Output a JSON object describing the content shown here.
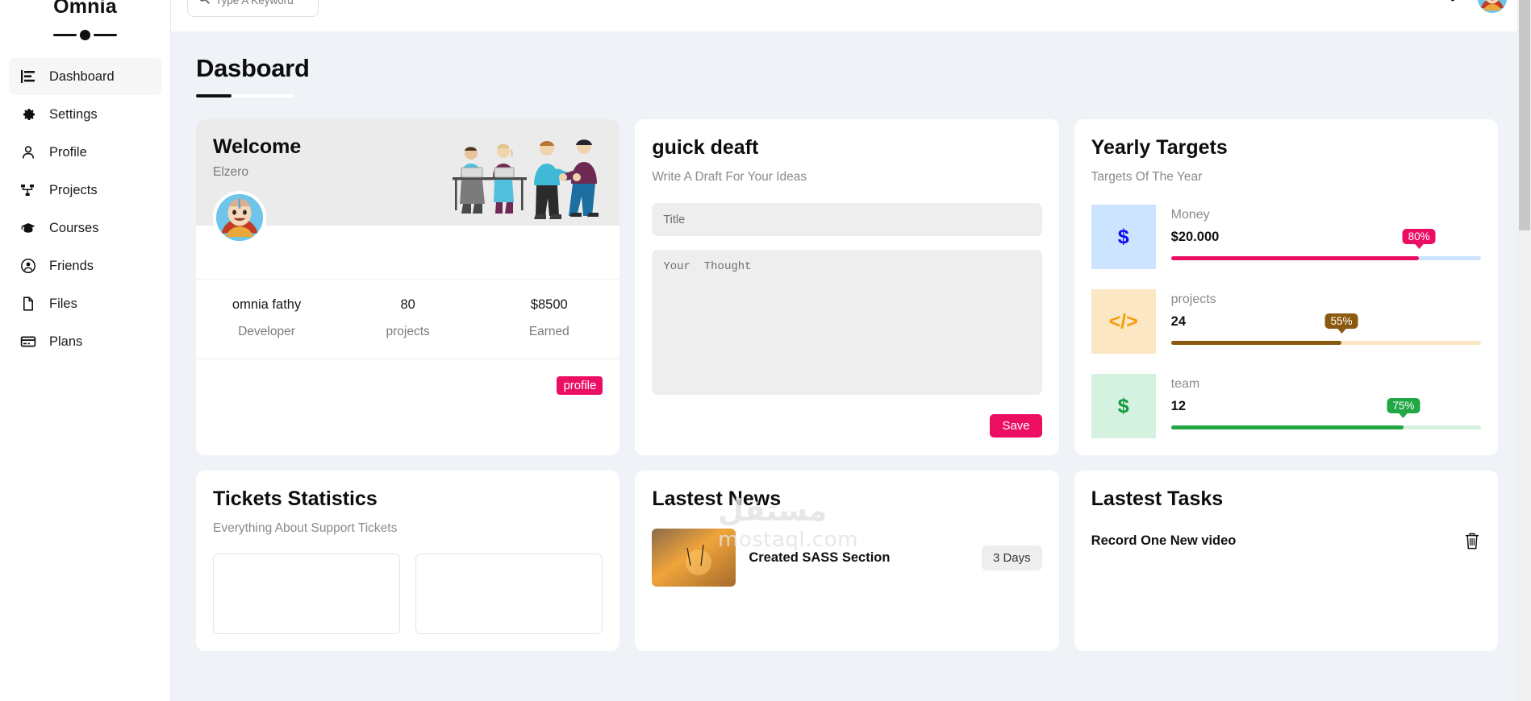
{
  "sidebar": {
    "brand": "Omnia",
    "items": [
      {
        "label": "Dashboard",
        "icon": "chart-bars-icon",
        "active": true
      },
      {
        "label": "Settings",
        "icon": "gear-icon",
        "active": false
      },
      {
        "label": "Profile",
        "icon": "user-icon",
        "active": false
      },
      {
        "label": "Projects",
        "icon": "sitemap-icon",
        "active": false
      },
      {
        "label": "Courses",
        "icon": "graduation-cap-icon",
        "active": false
      },
      {
        "label": "Friends",
        "icon": "user-circle-icon",
        "active": false
      },
      {
        "label": "Files",
        "icon": "file-icon",
        "active": false
      },
      {
        "label": "Plans",
        "icon": "credit-card-icon",
        "active": false
      }
    ]
  },
  "topbar": {
    "search_placeholder": "Type A Keyword",
    "search_value": "",
    "search_icon": "search-icon",
    "bell_icon": "bell-icon",
    "notification_dot_color": "#1b6ef3",
    "avatar_icon": "user-avatar"
  },
  "page": {
    "title": "Dasboard"
  },
  "welcome": {
    "title": "Welcome",
    "subtitle": "Elzero",
    "stats": [
      {
        "value": "omnia fathy",
        "label": "Developer"
      },
      {
        "value": "80",
        "label": "projects"
      },
      {
        "value": "$8500",
        "label": "Earned"
      }
    ],
    "button_label": "profile",
    "button_color": "#ec0e63"
  },
  "draft": {
    "title": "guick deaft",
    "subtitle": "Write A Draft For Your Ideas",
    "title_placeholder": "Title",
    "title_value": "",
    "thought_placeholder": "Your  Thought",
    "thought_value": "",
    "save_label": "Save",
    "save_color": "#ec0e63"
  },
  "targets": {
    "title": "Yearly Targets",
    "subtitle": "Targets Of The Year",
    "items": [
      {
        "name": "Money",
        "value": "$20.000",
        "percent": "80%",
        "percent_num": 80,
        "icon": "dollar-icon",
        "icon_glyph": "$",
        "icon_bg": "#cce4ff",
        "icon_color": "#0d0df3",
        "bar_bg": "#cce4ff",
        "bar_fill": "#ec0e63",
        "badge_bg": "#ec0e63"
      },
      {
        "name": "projects",
        "value": "24",
        "percent": "55%",
        "percent_num": 55,
        "icon": "code-icon",
        "icon_glyph": "</>",
        "icon_bg": "#fce7c4",
        "icon_color": "#f59e0b",
        "bar_bg": "#fce7c4",
        "bar_fill": "#8a5a10",
        "badge_bg": "#8a5a10"
      },
      {
        "name": "team",
        "value": "12",
        "percent": "75%",
        "percent_num": 75,
        "icon": "dollar-icon",
        "icon_glyph": "$",
        "icon_bg": "#d5f2e0",
        "icon_color": "#129a3f",
        "bar_bg": "#d5f2e0",
        "bar_fill": "#22a745",
        "badge_bg": "#22a745"
      }
    ]
  },
  "tickets": {
    "title": "Tickets Statistics",
    "subtitle": "Everything About Support Tickets"
  },
  "news": {
    "title": "Lastest News",
    "items": [
      {
        "thumb": "news-thumbnail",
        "headline": "Created SASS Section",
        "badge": "3 Days"
      }
    ]
  },
  "tasks": {
    "title": "Lastest Tasks",
    "items": [
      {
        "name": "Record One New video",
        "delete_icon": "trash-icon"
      }
    ]
  },
  "watermark": {
    "arabic": "مستقل",
    "latin": "mostaql.com"
  }
}
